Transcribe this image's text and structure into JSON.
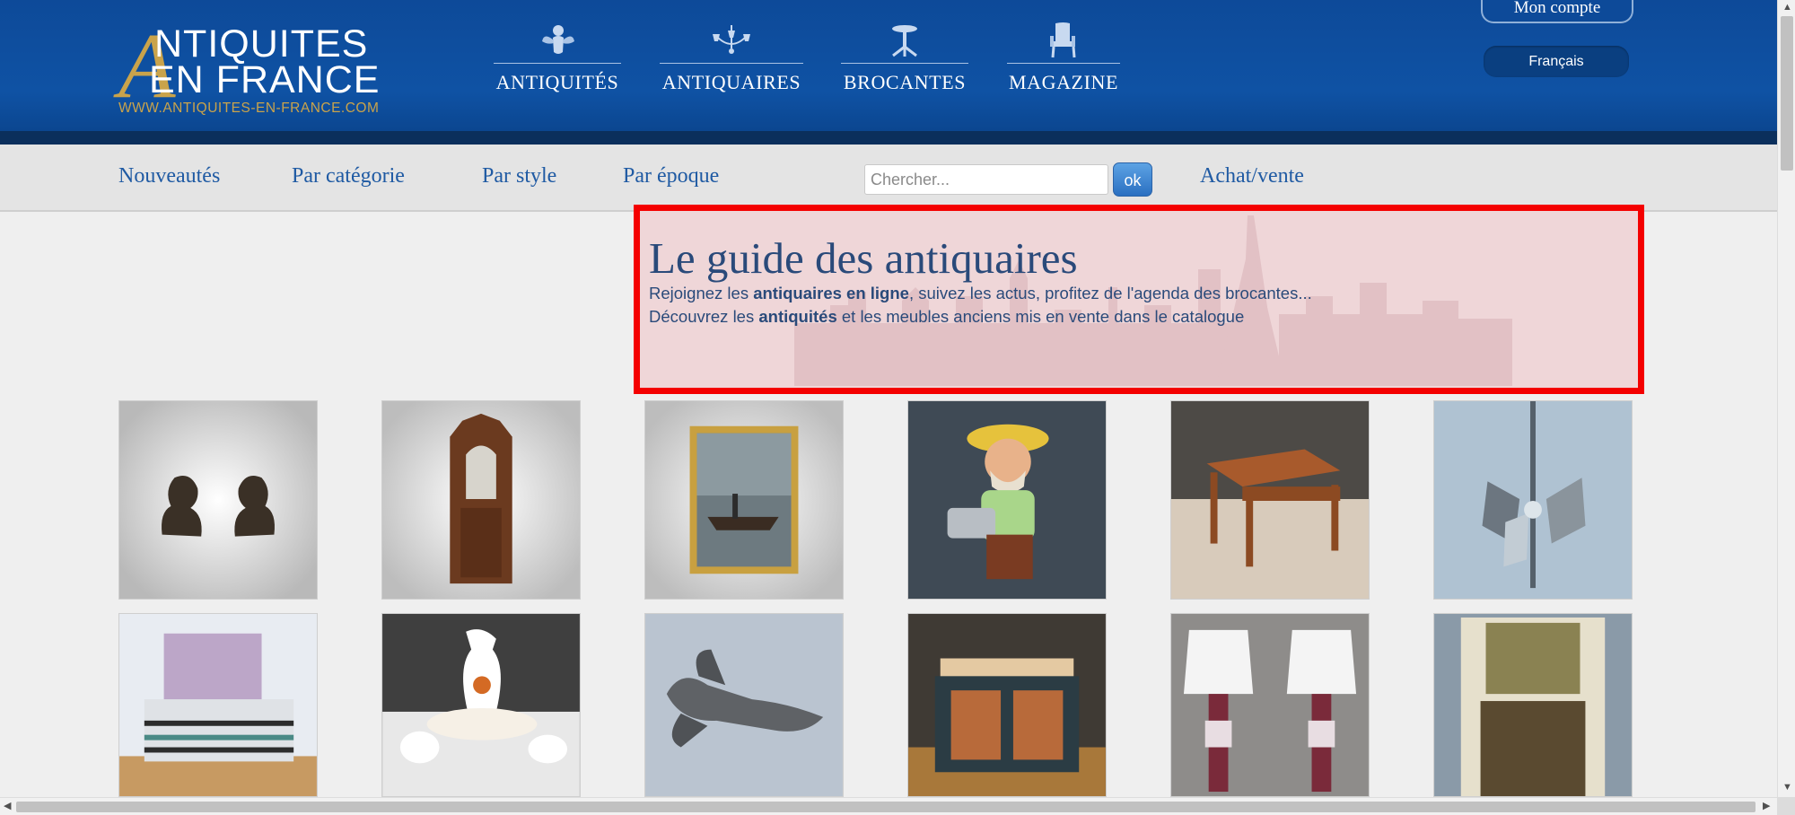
{
  "header": {
    "logo": {
      "initial": "A",
      "line1": "NTIQUITES",
      "line2": "EN FRANCE",
      "url": "WWW.ANTIQUITES-EN-FRANCE.COM"
    },
    "nav": [
      {
        "label": "ANTIQUITÉS",
        "icon": "cherub-icon"
      },
      {
        "label": "ANTIQUAIRES",
        "icon": "chandelier-icon"
      },
      {
        "label": "BROCANTES",
        "icon": "pedestal-table-icon"
      },
      {
        "label": "MAGAZINE",
        "icon": "armchair-icon"
      }
    ],
    "account_label": "Mon compte",
    "language_label": "Français",
    "colors": {
      "brand_blue": "#0f52a4",
      "gold": "#c9a34b"
    }
  },
  "subnav": {
    "links": [
      "Nouveautés",
      "Par catégorie",
      "Par style",
      "Par époque",
      "Achat/vente"
    ],
    "search": {
      "placeholder": "Chercher...",
      "value": "",
      "button_label": "ok"
    }
  },
  "hero": {
    "title": "Le guide des antiquaires",
    "line1": {
      "pre": "Rejoignez les ",
      "bold": "antiquaires en ligne",
      "post": ", suivez les actus, profitez de l'agenda des brocantes..."
    },
    "line2": {
      "pre": "Découvrez les ",
      "bold": "antiquités",
      "post": " et les meubles anciens mis en vente dans le catalogue"
    }
  },
  "products": [
    {
      "name": "bronze-busts-pair"
    },
    {
      "name": "gothic-oak-cabinet"
    },
    {
      "name": "framed-marine-painting"
    },
    {
      "name": "gardener-figurine"
    },
    {
      "name": "wooden-side-table"
    },
    {
      "name": "chrome-pendant-light"
    },
    {
      "name": "metal-double-bed"
    },
    {
      "name": "porcelain-toilet-set"
    },
    {
      "name": "pewter-lobster"
    },
    {
      "name": "painted-chest"
    },
    {
      "name": "pair-of-table-lamps"
    },
    {
      "name": "trumeau-mirror"
    }
  ]
}
